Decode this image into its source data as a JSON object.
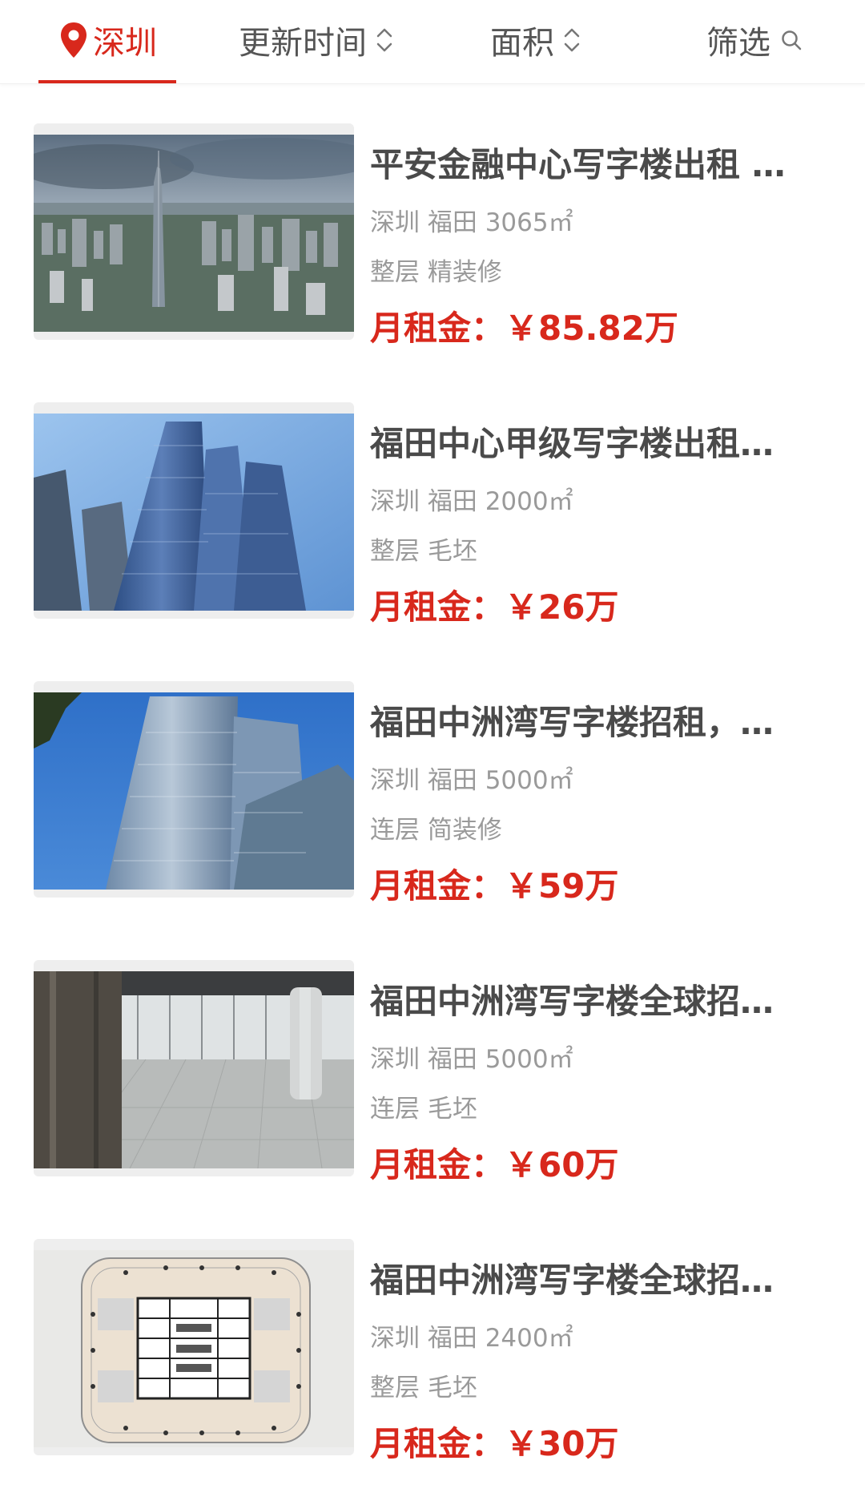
{
  "tabs": {
    "city": "深圳",
    "update_time": "更新时间",
    "area": "面积",
    "filter": "筛选"
  },
  "colors": {
    "accent": "#d8281c",
    "title": "#4a4a4a",
    "meta": "#9a9a9a"
  },
  "listings": [
    {
      "title": "平安金融中心写字楼出租 …",
      "location": "深圳 福田 3065㎡",
      "decoration": "整层 精装修",
      "price_label": "月租金：",
      "price": "￥85.82万",
      "image": "city-skyline-tower"
    },
    {
      "title": "福田中心甲级写字楼出租…",
      "location": "深圳 福田 2000㎡",
      "decoration": "整层 毛坯",
      "price_label": "月租金：",
      "price": "￥26万",
      "image": "glass-towers"
    },
    {
      "title": "福田中洲湾写字楼招租，…",
      "location": "深圳 福田 5000㎡",
      "decoration": "连层 简装修",
      "price_label": "月租金：",
      "price": "￥59万",
      "image": "glass-towers-sky"
    },
    {
      "title": "福田中洲湾写字楼全球招…",
      "location": "深圳 福田 5000㎡",
      "decoration": "连层 毛坯",
      "price_label": "月租金：",
      "price": "￥60万",
      "image": "empty-office-interior"
    },
    {
      "title": "福田中洲湾写字楼全球招…",
      "location": "深圳 福田 2400㎡",
      "decoration": "整层 毛坯",
      "price_label": "月租金：",
      "price": "￥30万",
      "image": "floor-plan"
    }
  ]
}
